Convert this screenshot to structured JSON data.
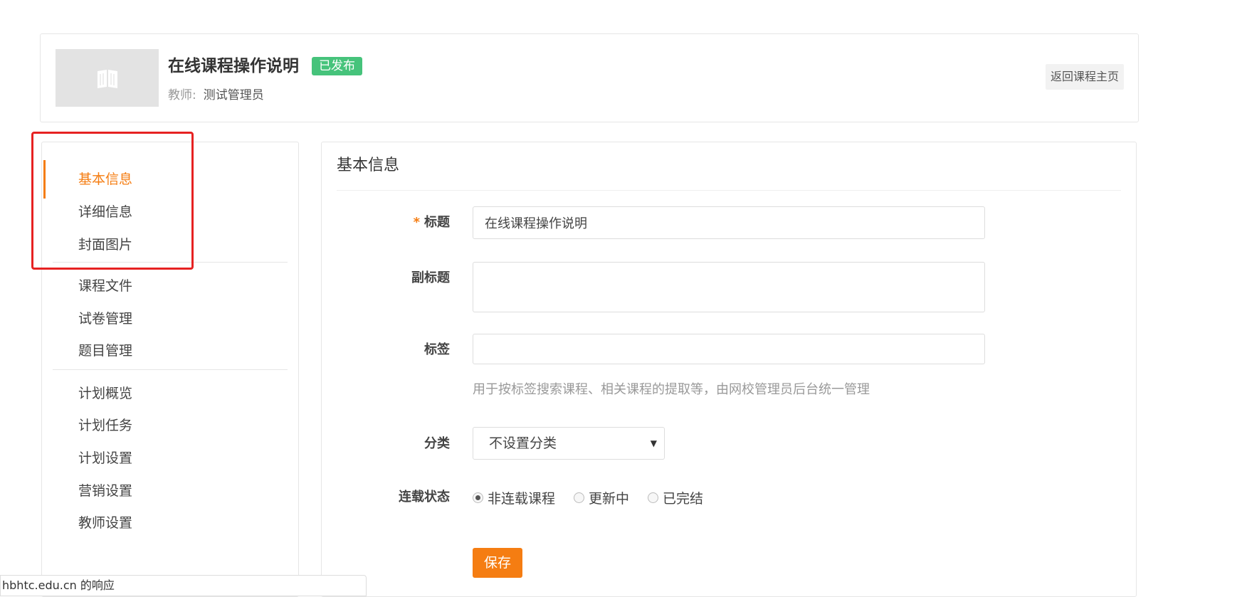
{
  "header": {
    "course_title": "在线课程操作说明",
    "status_badge": "已发布",
    "teacher_label": "教师:",
    "teacher_name": "测试管理员",
    "back_button": "返回课程主页"
  },
  "sidebar": {
    "groups": [
      [
        {
          "label": "基本信息",
          "active": true
        },
        {
          "label": "详细信息"
        },
        {
          "label": "封面图片"
        }
      ],
      [
        {
          "label": "课程文件"
        },
        {
          "label": "试卷管理"
        },
        {
          "label": "题目管理"
        }
      ],
      [
        {
          "label": "计划概览"
        },
        {
          "label": "计划任务"
        },
        {
          "label": "计划设置"
        },
        {
          "label": "营销设置"
        },
        {
          "label": "教师设置"
        }
      ]
    ]
  },
  "form": {
    "section_title": "基本信息",
    "title_required_mark": "*",
    "title_label": "标题",
    "title_value": "在线课程操作说明",
    "subtitle_label": "副标题",
    "subtitle_value": "",
    "tags_label": "标签",
    "tags_value": "",
    "tags_hint": "用于按标签搜索课程、相关课程的提取等，由网校管理员后台统一管理",
    "category_label": "分类",
    "category_value": "不设置分类",
    "serial_label": "连载状态",
    "serial_options": [
      {
        "label": "非连载课程",
        "checked": true
      },
      {
        "label": "更新中",
        "checked": false
      },
      {
        "label": "已完结",
        "checked": false
      }
    ],
    "save_button": "保存"
  },
  "statusbar": {
    "text": "hbhtc.edu.cn 的响应"
  },
  "colors": {
    "accent": "#f57d12",
    "badge_green": "#46c37b",
    "highlight_red": "#e62222"
  }
}
